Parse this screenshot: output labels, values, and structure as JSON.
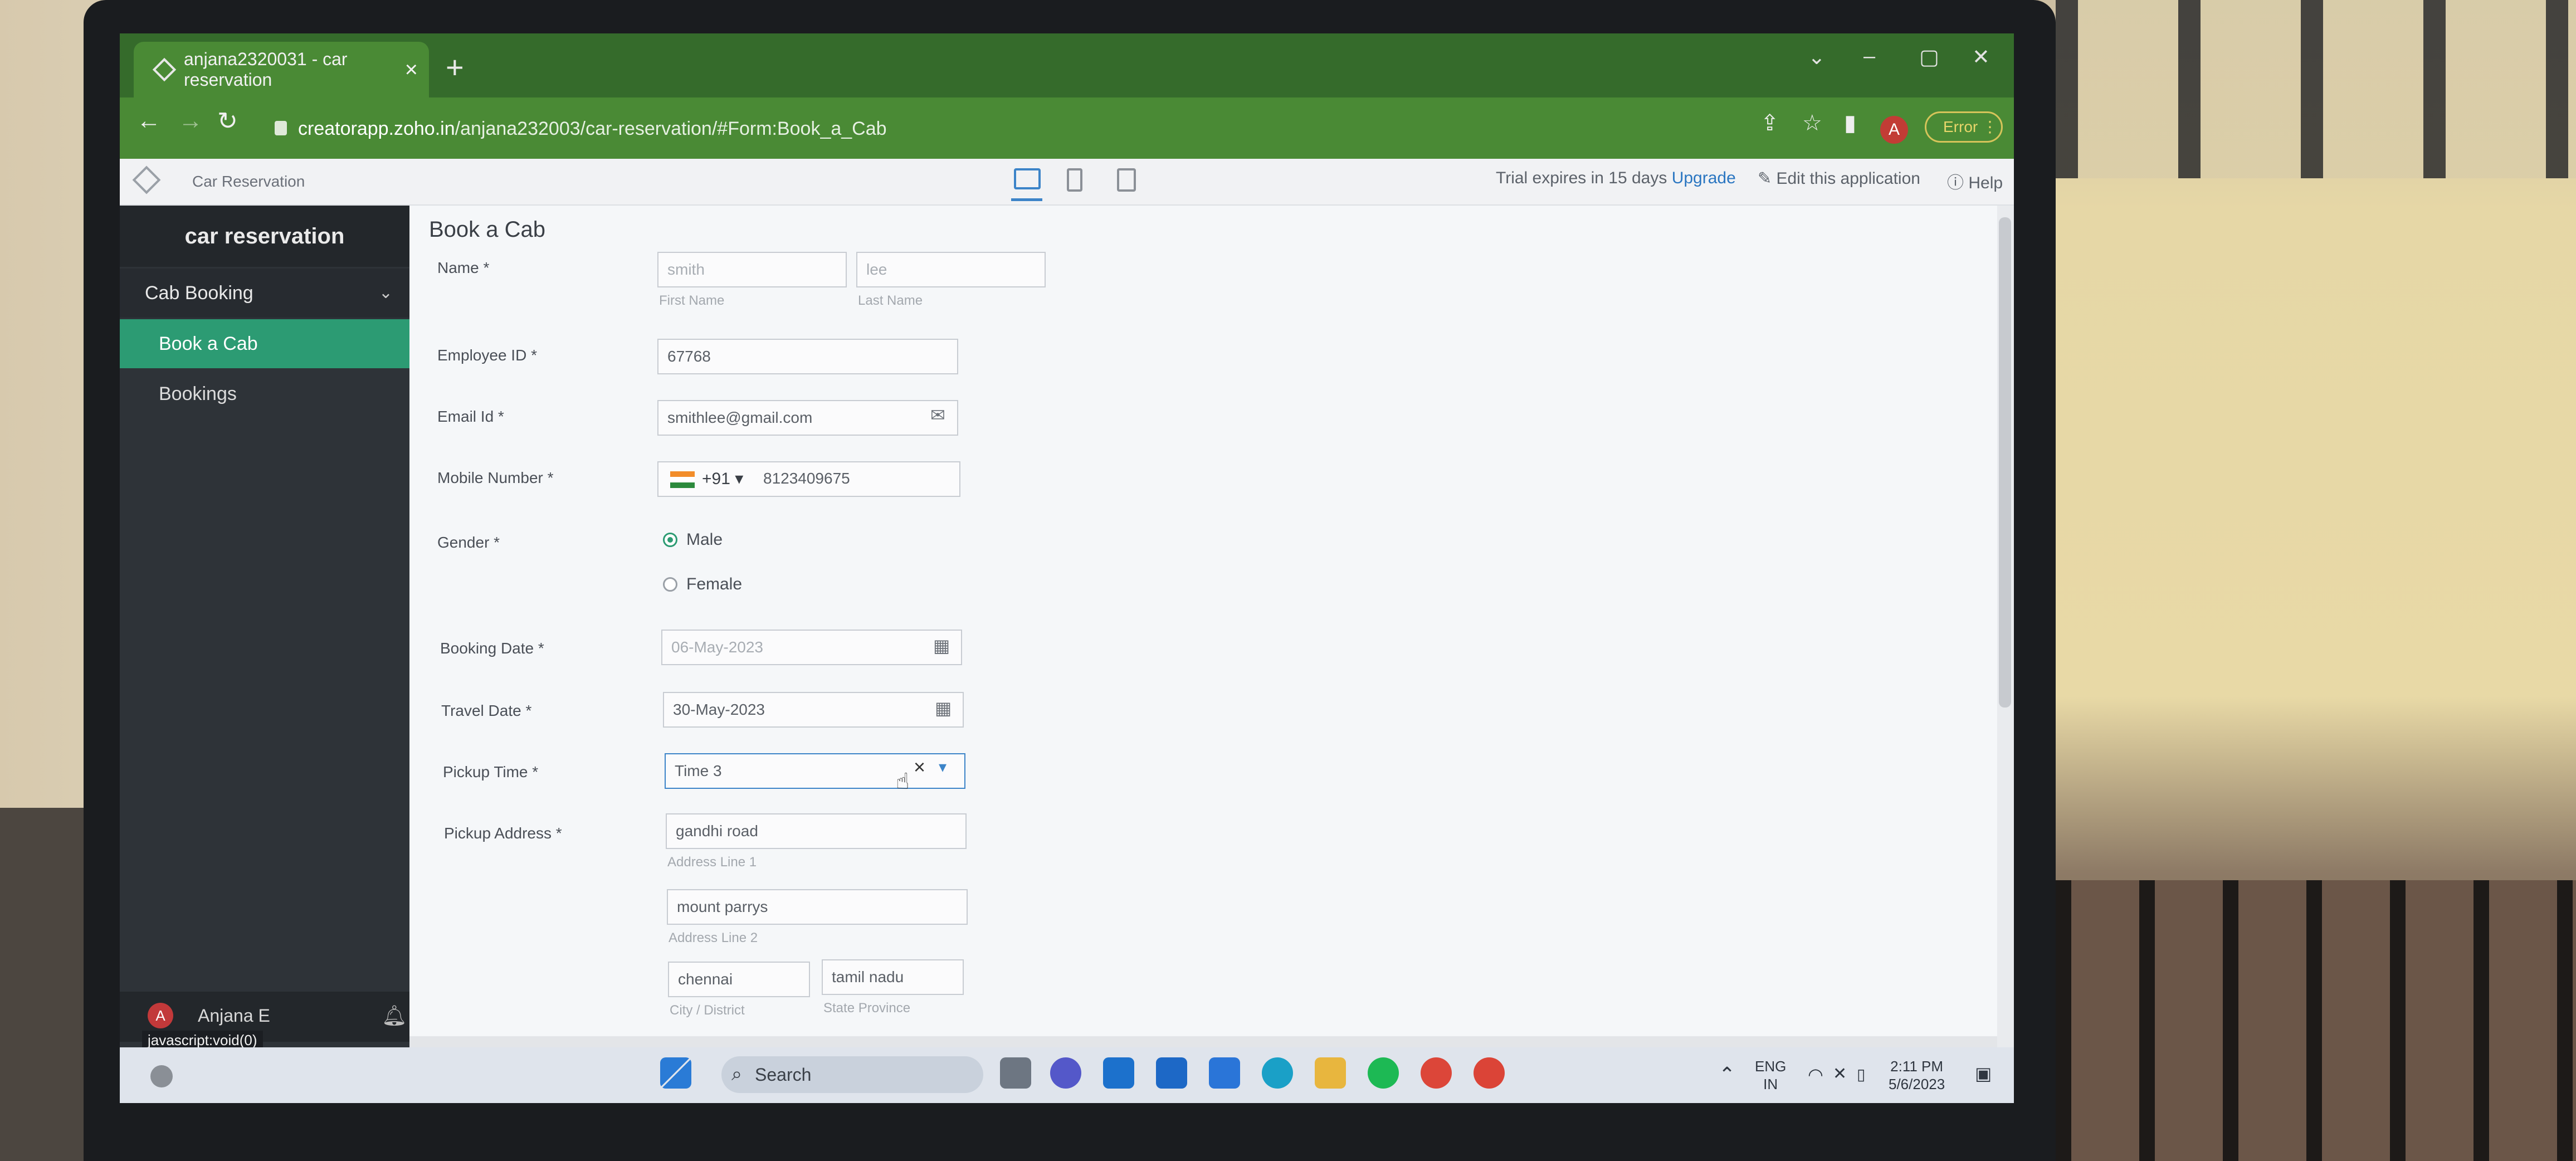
{
  "browser": {
    "tab_title": "anjana2320031 - car reservation",
    "url_host": "creatorapp.zoho.in",
    "url_path": "/anjana232003/car-reservation/#Form:Book_a_Cab",
    "error_label": "Error",
    "avatar_letter": "A"
  },
  "app_header": {
    "app_name": "Car Reservation",
    "trial_text": "Trial expires in 15 days",
    "upgrade_label": "Upgrade",
    "edit_label": "Edit this application",
    "help_label": "Help"
  },
  "sidebar": {
    "title": "car reservation",
    "group_label": "Cab Booking",
    "items": [
      {
        "label": "Book a Cab"
      },
      {
        "label": "Bookings"
      }
    ],
    "user_name": "Anjana E",
    "user_initial": "A",
    "status_url": "javascript:void(0)"
  },
  "form": {
    "title": "Book a Cab",
    "name_label": "Name *",
    "first_name_value": "smith",
    "last_name_value": "lee",
    "first_name_caption": "First Name",
    "last_name_caption": "Last Name",
    "employee_id_label": "Employee ID *",
    "employee_id_value": "67768",
    "email_label": "Email Id *",
    "email_value": "smithlee@gmail.com",
    "mobile_label": "Mobile Number *",
    "country_code": "+91",
    "mobile_value": "8123409675",
    "gender_label": "Gender *",
    "gender_options": [
      "Male",
      "Female"
    ],
    "booking_date_label": "Booking Date *",
    "booking_date_value": "06-May-2023",
    "travel_date_label": "Travel Date *",
    "travel_date_value": "30-May-2023",
    "pickup_time_label": "Pickup Time *",
    "pickup_time_value": "Time 3",
    "pickup_address_label": "Pickup Address *",
    "address_line1_value": "gandhi road",
    "address_line1_caption": "Address Line 1",
    "address_line2_value": "mount parrys",
    "address_line2_caption": "Address Line 2",
    "city_value": "chennai",
    "city_caption": "City / District",
    "state_value": "tamil nadu",
    "state_caption": "State Province"
  },
  "taskbar": {
    "search_label": "Search",
    "lang_line1": "ENG",
    "lang_line2": "IN",
    "time": "2:11 PM",
    "date": "5/6/2023"
  },
  "colors": {
    "accent_green": "#2c9b73",
    "browser_theme": "#4a8a35",
    "sidebar_bg": "#2e3338"
  }
}
